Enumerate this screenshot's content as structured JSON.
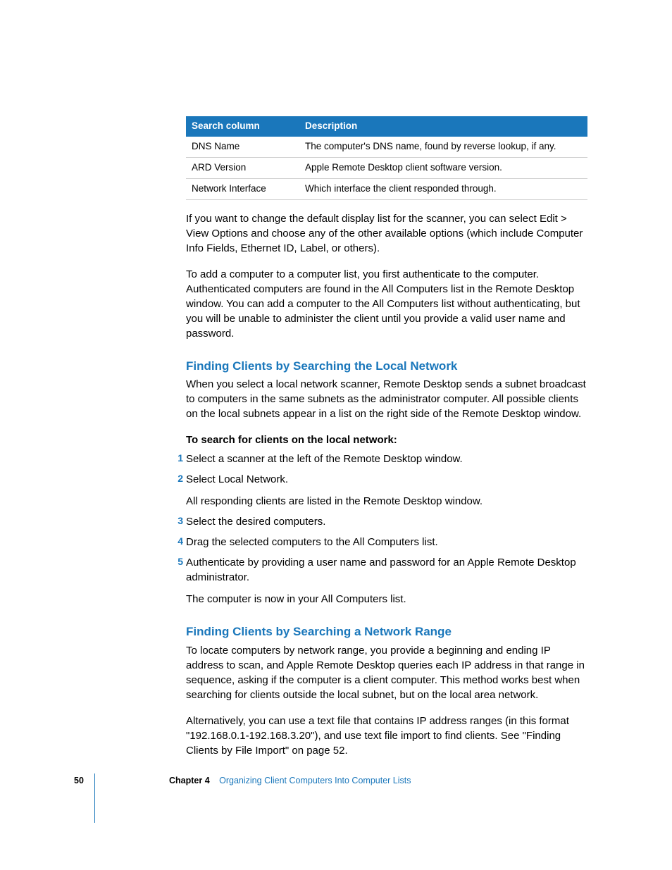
{
  "table": {
    "headers": [
      "Search column",
      "Description"
    ],
    "rows": [
      [
        "DNS Name",
        "The computer's DNS name, found by reverse lookup, if any."
      ],
      [
        "ARD Version",
        "Apple Remote Desktop client software version."
      ],
      [
        "Network Interface",
        "Which interface the client responded through."
      ]
    ]
  },
  "para1": "If you want to change the default display list for the scanner, you can select Edit > View Options and choose any of the other available options (which include Computer Info Fields, Ethernet ID, Label, or others).",
  "para2": "To add a computer to a computer list, you first authenticate to the computer. Authenticated computers are found in the All Computers list in the Remote Desktop window. You can add a computer to the All Computers list without authenticating, but you will be unable to administer the client until you provide a valid user name and password.",
  "section1": {
    "heading": "Finding Clients by Searching the Local Network",
    "intro": "When you select a local network scanner, Remote Desktop sends a subnet broadcast to computers in the same subnets as the administrator computer. All possible clients on the local subnets appear in a list on the right side of the Remote Desktop window.",
    "subhead": "To search for clients on the local network:",
    "steps": [
      {
        "n": "1",
        "text": "Select a scanner at the left of the Remote Desktop window."
      },
      {
        "n": "2",
        "text": "Select Local Network.",
        "follow": "All responding clients are listed in the Remote Desktop window."
      },
      {
        "n": "3",
        "text": "Select the desired computers."
      },
      {
        "n": "4",
        "text": "Drag the selected computers to the All Computers list."
      },
      {
        "n": "5",
        "text": "Authenticate by providing a user name and password for an Apple Remote Desktop administrator.",
        "follow": "The computer is now in your All Computers list."
      }
    ]
  },
  "section2": {
    "heading": "Finding Clients by Searching a Network Range",
    "p1": "To locate computers by network range, you provide a beginning and ending IP address to scan, and Apple Remote Desktop queries each IP address in that range in sequence, asking if the computer is a client computer. This method works best when searching for clients outside the local subnet, but on the local area network.",
    "p2": "Alternatively, you can use a text file that contains IP address ranges (in this format \"192.168.0.1-192.168.3.20\"), and use text file import to find clients. See \"Finding Clients by File Import\" on page 52."
  },
  "footer": {
    "page": "50",
    "chapter_label": "Chapter 4",
    "chapter_title": "Organizing Client Computers Into Computer Lists"
  }
}
